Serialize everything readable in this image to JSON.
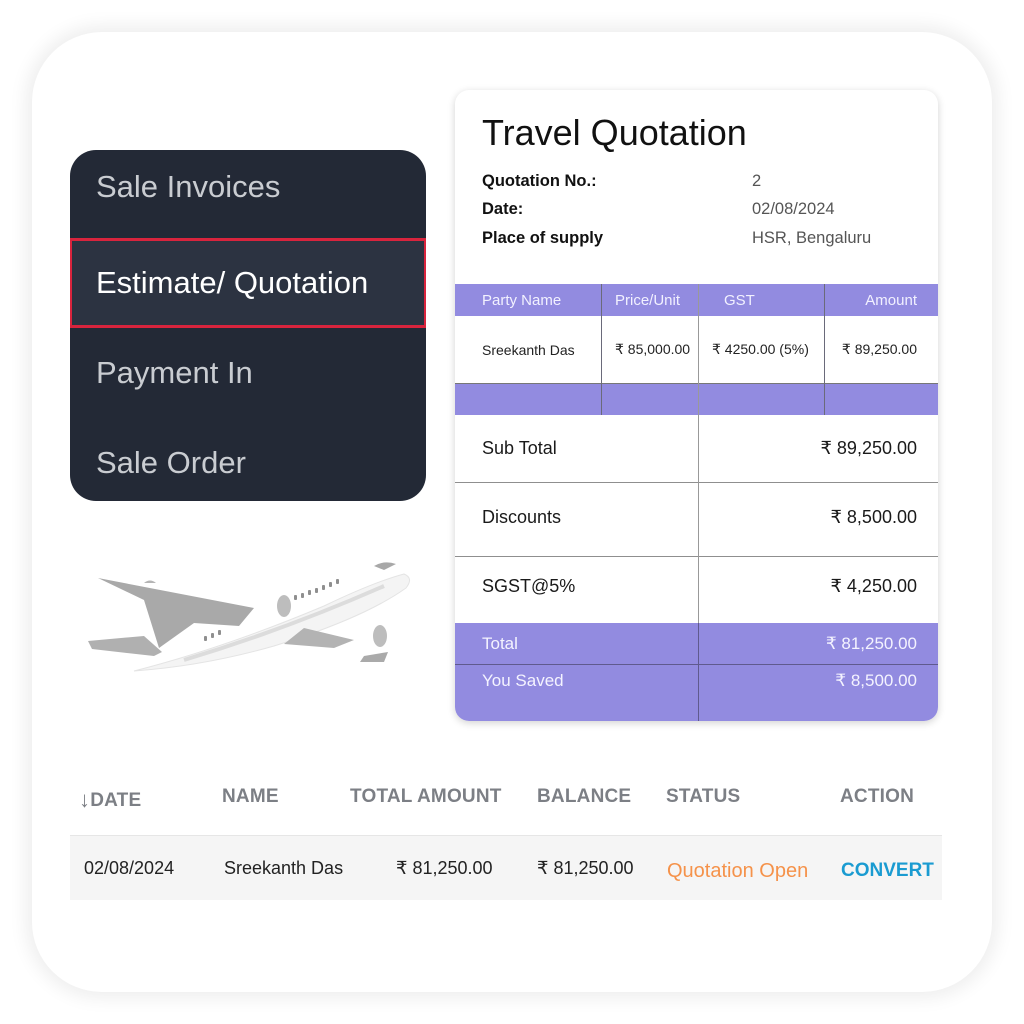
{
  "menu": {
    "items": [
      {
        "label": "Sale Invoices",
        "active": false
      },
      {
        "label": "Estimate/ Quotation",
        "active": true
      },
      {
        "label": "Payment In",
        "active": false
      },
      {
        "label": "Sale Order",
        "active": false
      }
    ],
    "highlight_color": "#d8243d"
  },
  "illustration": {
    "icon": "airplane-icon"
  },
  "quotation": {
    "title": "Travel Quotation",
    "meta": [
      {
        "label": "Quotation No.:",
        "value": "2"
      },
      {
        "label": "Date:",
        "value": "02/08/2024"
      },
      {
        "label": "Place of supply",
        "value": "HSR, Bengaluru"
      }
    ],
    "columns": [
      "Party Name",
      "Price/Unit",
      "GST",
      "Amount"
    ],
    "rows": [
      {
        "party": "Sreekanth Das",
        "price": "₹ 85,000.00",
        "gst": "₹ 4250.00 (5%)",
        "amount": "₹ 89,250.00"
      }
    ],
    "summary": [
      {
        "label": "Sub Total",
        "value": "₹ 89,250.00"
      },
      {
        "label": "Discounts",
        "value": "₹ 8,500.00"
      },
      {
        "label": "SGST@5%",
        "value": "₹ 4,250.00"
      }
    ],
    "total": {
      "label": "Total",
      "value": "₹ 81,250.00"
    },
    "saved": {
      "label": "You Saved",
      "value": "₹ 8,500.00"
    },
    "accent_color": "#928be0"
  },
  "list": {
    "sort_icon": "arrow-down-icon",
    "headers": [
      "DATE",
      "NAME",
      "TOTAL AMOUNT",
      "BALANCE",
      "STATUS",
      "ACTION"
    ],
    "rows": [
      {
        "date": "02/08/2024",
        "name": "Sreekanth Das",
        "total": "₹ 81,250.00",
        "balance": "₹ 81,250.00",
        "status": "Quotation Open",
        "action": "CONVERT"
      }
    ],
    "status_color": "#f5924a",
    "action_color": "#1a9bd1"
  }
}
